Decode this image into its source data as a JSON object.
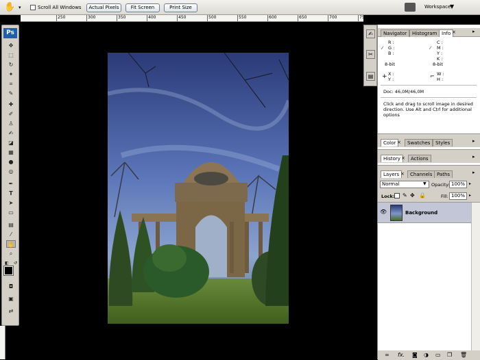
{
  "options_bar": {
    "scroll_all_windows_label": "Scroll All Windows",
    "actual_pixels_label": "Actual Pixels",
    "fit_screen_label": "Fit Screen",
    "print_size_label": "Print Size",
    "workspace_label": "Workspace"
  },
  "ruler": {
    "ticks": [
      "250",
      "300",
      "350",
      "400",
      "450",
      "500",
      "550",
      "600",
      "650",
      "700",
      "750"
    ]
  },
  "toolbox": {
    "logo": "Ps"
  },
  "info_panel": {
    "tabs": [
      "Navigator",
      "Histogram",
      "Info"
    ],
    "active_tab": "Info",
    "rgb_labels": [
      "R :",
      "G :",
      "B :"
    ],
    "cmyk_labels": [
      "C :",
      "M :",
      "Y :",
      "K :"
    ],
    "bit_left": "8-bit",
    "bit_right": "8-bit",
    "xy_labels": [
      "X :",
      "Y :"
    ],
    "wh_labels": [
      "W :",
      "H :"
    ],
    "doc": "Doc: 46,0M/46,0M",
    "hint": "Click and drag to scroll image in desired direction. Use Alt and Ctrl for additional options"
  },
  "color_panel": {
    "tabs": [
      "Color",
      "Swatches",
      "Styles"
    ]
  },
  "history_panel": {
    "tabs": [
      "History",
      "Actions"
    ]
  },
  "layers_panel": {
    "tabs": [
      "Layers",
      "Channels",
      "Paths"
    ],
    "blend_mode": "Normal",
    "opacity_label": "Opacity:",
    "opacity_value": "100%",
    "lock_label": "Lock:",
    "fill_label": "Fill:",
    "fill_value": "100%",
    "layers": [
      {
        "name": "Background"
      }
    ]
  },
  "colors": {
    "panel_bg": "#d4d0c8",
    "selected_layer": "#c2c6d6",
    "sky": "#4a63a8",
    "grass": "#5b7a2e"
  }
}
